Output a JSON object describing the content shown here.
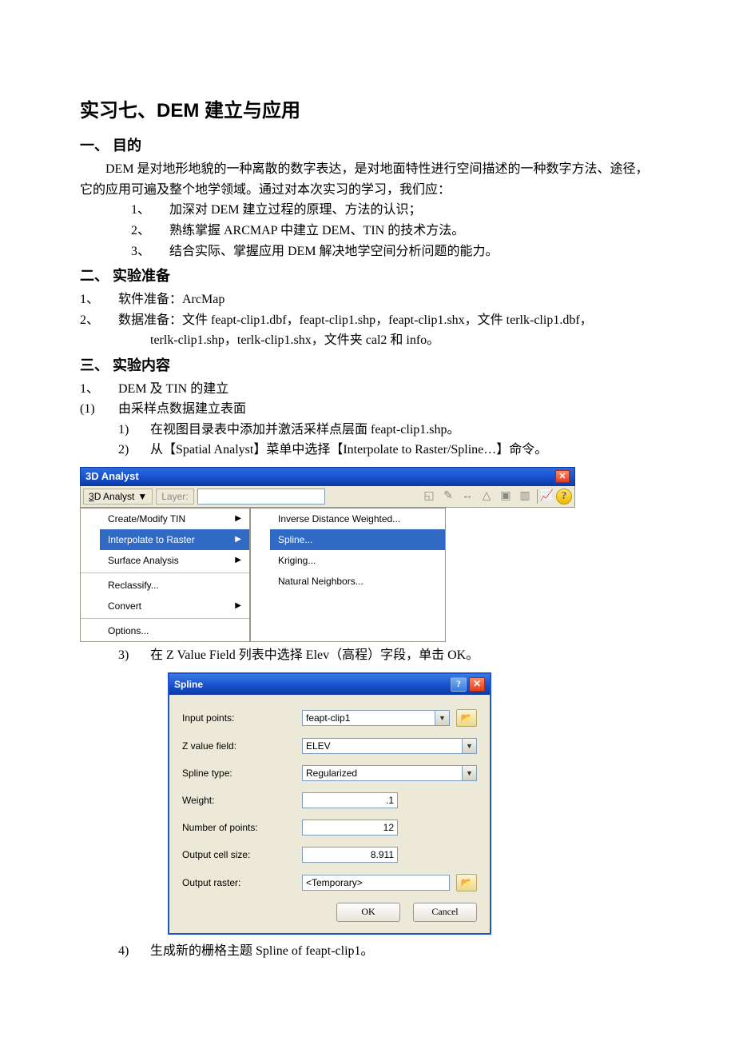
{
  "title": "实习七、DEM 建立与应用",
  "s1": {
    "head": "一、  目的",
    "para": "DEM 是对地形地貌的一种离散的数字表达，是对地面特性进行空间描述的一种数字方法、途径，它的应用可遍及整个地学领域。通过对本次实习的学习，我们应：",
    "items": [
      "加深对 DEM 建立过程的原理、方法的认识；",
      "熟练掌握 ARCMAP 中建立 DEM、TIN 的技术方法。",
      "结合实际、掌握应用 DEM 解决地学空间分析问题的能力。"
    ]
  },
  "s2": {
    "head": "二、  实验准备",
    "i1": {
      "n": "1、",
      "t": "软件准备：ArcMap"
    },
    "i2": {
      "n": "2、",
      "t": "数据准备：文件 feapt-clip1.dbf，feapt-clip1.shp，feapt-clip1.shx，文件 terlk-clip1.dbf，"
    },
    "i2b": "terlk-clip1.shp，terlk-clip1.shx，文件夹 cal2 和 info。"
  },
  "s3": {
    "head": "三、  实验内容",
    "i1": {
      "n": "1、",
      "t": "DEM 及 TIN 的建立"
    },
    "i2": {
      "n": "(1)",
      "t": "由采样点数据建立表面"
    },
    "step1": {
      "n": "1)",
      "t": "在视图目录表中添加并激活采样点层面 feapt-clip1.shp。"
    },
    "step2": {
      "n": "2)",
      "t": "从【Spatial Analyst】菜单中选择【Interpolate to Raster/Spline…】命令。"
    },
    "step3": {
      "n": "3)",
      "t": "在 Z Value Field 列表中选择 Elev（高程）字段，单击 OK。"
    },
    "step4": {
      "n": "4)",
      "t": "生成新的栅格主题 Spline of feapt-clip1。"
    }
  },
  "toolbar": {
    "title": "3D Analyst",
    "btn": "3D Analyst",
    "layer": "Layer:",
    "menu_left": [
      "Create/Modify TIN",
      "Interpolate to Raster",
      "Surface Analysis",
      "Reclassify...",
      "Convert",
      "Options..."
    ],
    "menu_right": [
      "Inverse Distance Weighted...",
      "Spline...",
      "Kriging...",
      "Natural Neighbors..."
    ]
  },
  "dlg": {
    "title": "Spline",
    "rows": {
      "input_points": {
        "label": "Input points:",
        "value": "feapt-clip1"
      },
      "z_value": {
        "label": "Z value field:",
        "value": "ELEV"
      },
      "spline_type": {
        "label": "Spline type:",
        "value": "Regularized"
      },
      "weight": {
        "label": "Weight:",
        "value": ".1"
      },
      "npoints": {
        "label": "Number of points:",
        "value": "12"
      },
      "cellsize": {
        "label": "Output cell size:",
        "value": "8.911"
      },
      "outraster": {
        "label": "Output raster:",
        "value": "<Temporary>"
      }
    },
    "ok": "OK",
    "cancel": "Cancel"
  }
}
